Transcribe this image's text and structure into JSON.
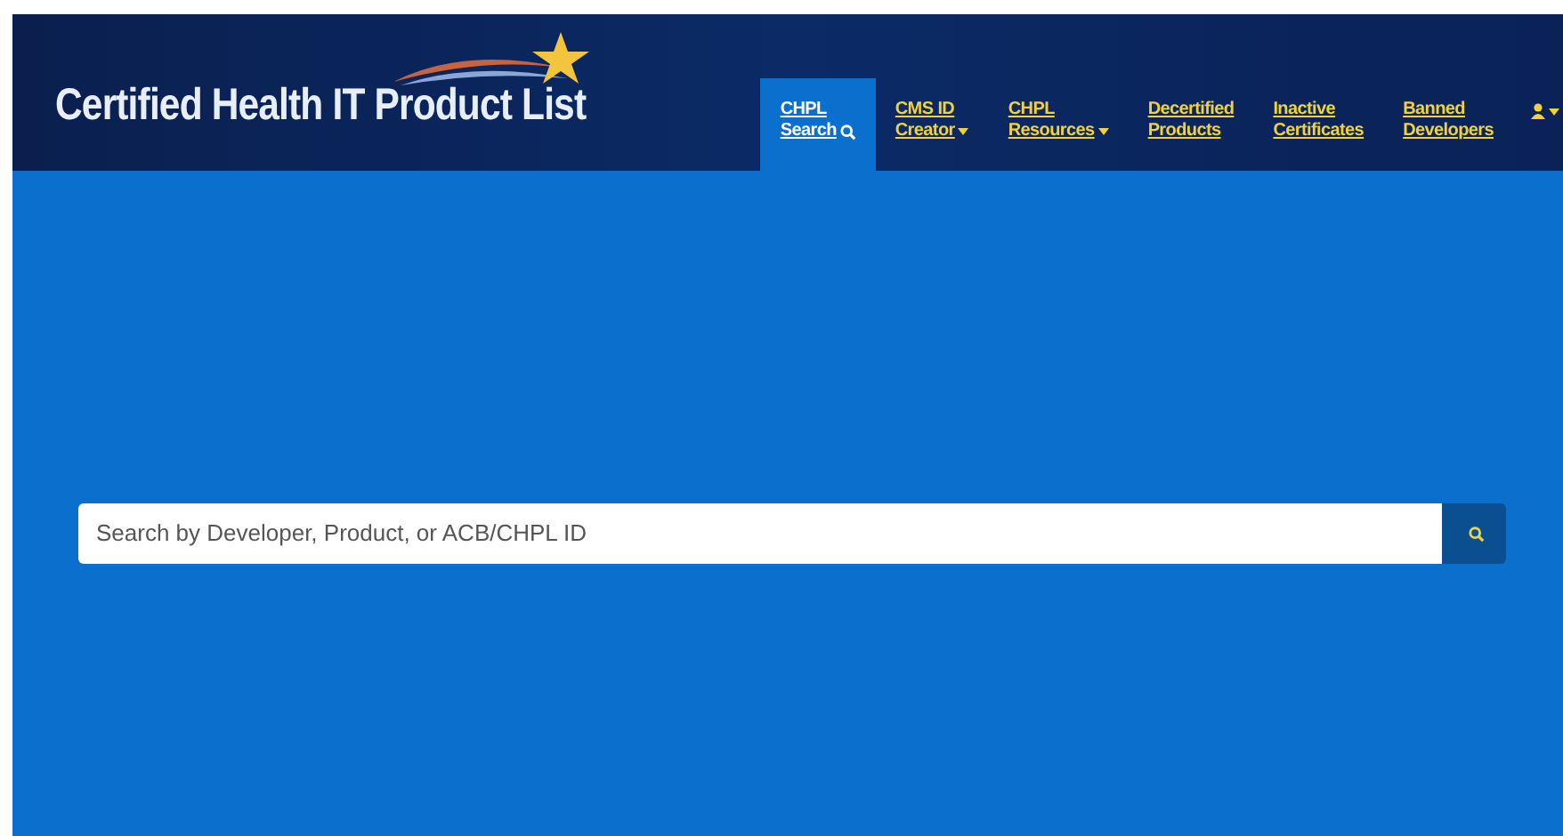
{
  "header": {
    "title": "Certified Health IT Product List"
  },
  "nav": [
    {
      "lines": [
        "CHPL",
        "Search"
      ],
      "kind": "search",
      "selected": true
    },
    {
      "lines": [
        "CMS ID",
        "Creator"
      ],
      "kind": "dropdown",
      "selected": false
    },
    {
      "lines": [
        "CHPL",
        "Resources"
      ],
      "kind": "dropdown",
      "selected": false
    },
    {
      "lines": [
        "Decertified",
        "Products"
      ],
      "kind": "link",
      "selected": false
    },
    {
      "lines": [
        "Inactive",
        "Certificates"
      ],
      "kind": "link",
      "selected": false
    },
    {
      "lines": [
        "Banned",
        "Developers"
      ],
      "kind": "link",
      "selected": false
    }
  ],
  "search": {
    "placeholder": "Search by Developer, Product, or ACB/CHPL ID"
  }
}
